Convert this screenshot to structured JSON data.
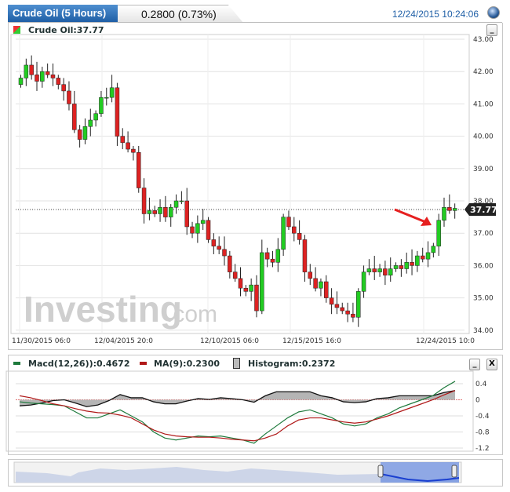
{
  "header": {
    "tab_title": "Crude Oil (5 Hours)",
    "change": "0.2800 (0.73%)",
    "timestamp": "12/24/2015 10:24:06"
  },
  "main": {
    "legend": "Crude Oil:37.77",
    "last_price": "37.77",
    "watermark": "Investing",
    "watermark_suffix": ".com",
    "minimize": "_"
  },
  "chart_data": [
    {
      "type": "candlestick",
      "title": "Crude Oil (5 Hours)",
      "ylim": [
        34,
        43
      ],
      "yticks": [
        "43.00",
        "42.00",
        "41.00",
        "40.00",
        "39.00",
        "38.00",
        "37.00",
        "36.00",
        "35.00",
        "34.00"
      ],
      "xticks": [
        "11/30/2015 06:0",
        "12/04/2015 20:0",
        "12/10/2015 06:0",
        "12/15/2015 16:0",
        "12/24/2015 10:0"
      ],
      "closes": [
        41.8,
        42.2,
        41.9,
        41.7,
        42.0,
        41.9,
        41.8,
        41.6,
        41.4,
        41.0,
        40.2,
        39.9,
        40.3,
        40.5,
        40.7,
        41.2,
        41.2,
        41.5,
        40.0,
        39.8,
        39.6,
        39.5,
        38.4,
        37.6,
        37.7,
        37.6,
        37.8,
        37.5,
        37.8,
        38.0,
        38.0,
        37.2,
        37.0,
        37.3,
        37.4,
        36.8,
        36.6,
        36.5,
        36.3,
        35.8,
        35.6,
        35.3,
        35.2,
        35.4,
        34.6,
        36.4,
        36.2,
        36.1,
        36.5,
        37.5,
        37.2,
        37.0,
        36.8,
        35.8,
        35.6,
        35.3,
        35.5,
        35.0,
        34.8,
        34.7,
        34.6,
        34.5,
        34.4,
        35.2,
        35.8,
        35.9,
        35.8,
        35.9,
        35.7,
        35.9,
        36.0,
        35.9,
        36.1,
        36.0,
        36.3,
        36.2,
        36.4,
        36.6,
        37.4,
        37.8,
        37.7,
        37.77
      ],
      "open_first": 41.6
    },
    {
      "type": "line",
      "title": "MACD",
      "ylim": [
        -1.2,
        0.55
      ],
      "yticks": [
        "0.4",
        "0",
        "-0.4",
        "-0.8",
        "-1.2"
      ],
      "series": [
        {
          "name": "Macd(12,26)",
          "color": "#1e7a3c",
          "values": [
            -0.05,
            -0.08,
            -0.1,
            -0.12,
            -0.15,
            -0.3,
            -0.45,
            -0.45,
            -0.35,
            -0.25,
            -0.4,
            -0.55,
            -0.8,
            -0.95,
            -1.0,
            -0.95,
            -0.9,
            -0.92,
            -0.9,
            -0.95,
            -1.0,
            -1.08,
            -0.85,
            -0.65,
            -0.45,
            -0.3,
            -0.25,
            -0.35,
            -0.45,
            -0.6,
            -0.65,
            -0.6,
            -0.45,
            -0.35,
            -0.2,
            -0.1,
            0.0,
            0.1,
            0.3,
            0.46
          ]
        },
        {
          "name": "MA(9)",
          "color": "#b01818",
          "values": [
            0.1,
            0.05,
            -0.02,
            -0.1,
            -0.15,
            -0.22,
            -0.28,
            -0.32,
            -0.33,
            -0.38,
            -0.45,
            -0.6,
            -0.75,
            -0.85,
            -0.9,
            -0.92,
            -0.93,
            -0.93,
            -0.95,
            -0.98,
            -1.0,
            -1.02,
            -0.95,
            -0.85,
            -0.65,
            -0.5,
            -0.45,
            -0.45,
            -0.5,
            -0.55,
            -0.58,
            -0.55,
            -0.48,
            -0.4,
            -0.3,
            -0.2,
            -0.1,
            0.0,
            0.12,
            0.23
          ]
        }
      ]
    }
  ],
  "macd": {
    "legend_macd": "Macd(12,26)):0.4672",
    "legend_ma": "MA(9):0.2300",
    "legend_hist": "Histogram:0.2372",
    "minimize": "_",
    "close": "X"
  }
}
